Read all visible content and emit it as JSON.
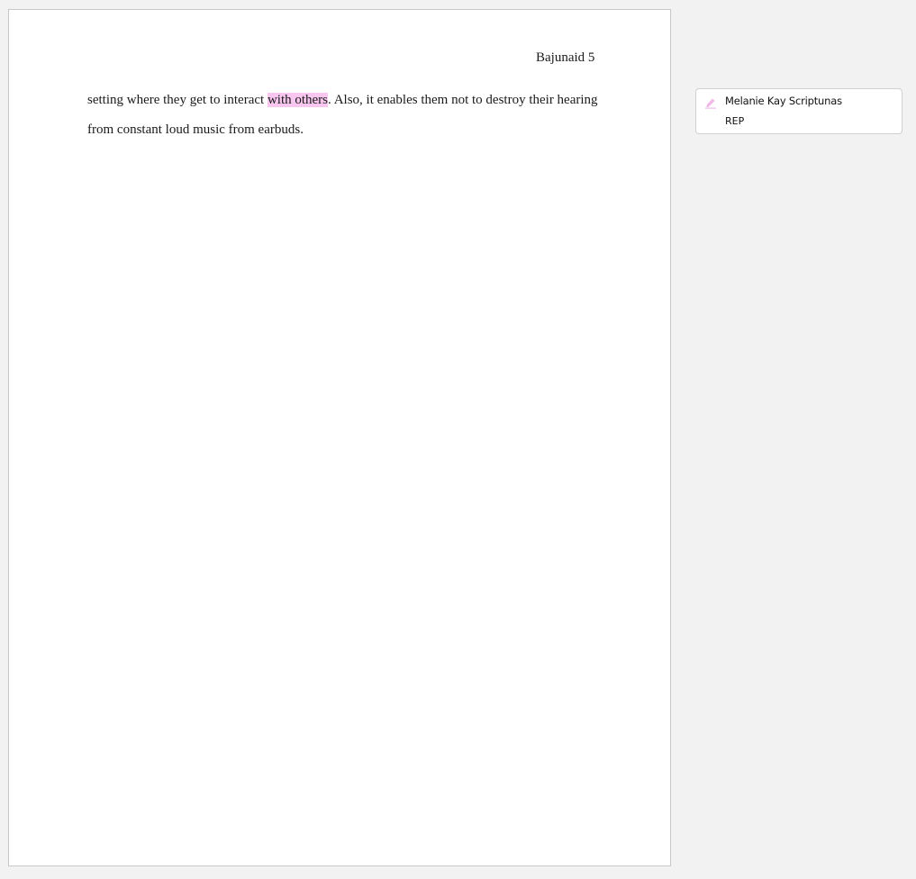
{
  "document": {
    "running_header": "Bajunaid 5",
    "paragraph": {
      "line1_before": "setting where they get to interact ",
      "line1_highlight": "with others",
      "line1_after": ". Also, it enables them not to destroy their hearing",
      "line2": "from constant loud music from earbuds."
    },
    "highlight_color": "#f9c6f0"
  },
  "comments": [
    {
      "icon": "highlighter-icon",
      "author": "Melanie Kay Scriptunas",
      "text": "REP"
    }
  ]
}
